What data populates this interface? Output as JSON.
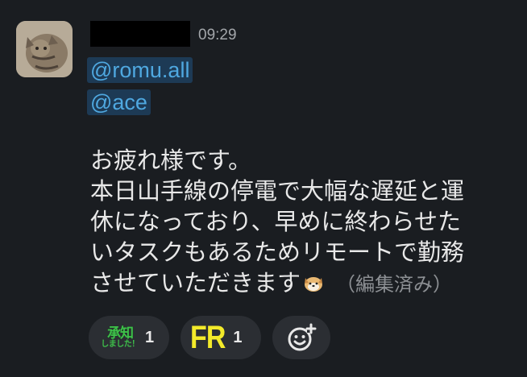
{
  "message": {
    "time": "09:29",
    "mentions": [
      "@romu.all",
      "@ace"
    ],
    "lines": [
      "お疲れ様です。",
      "本日山手線の停電で大幅な遅延と運",
      "休になっており、早めに終わらせた",
      "いタスクもあるためリモートで勤務",
      "させていただきます"
    ],
    "edited_label": "（編集済み）",
    "inline_emoji": "dog-face-emoji"
  },
  "reactions": [
    {
      "name": "承知しました",
      "text_top": "承知",
      "text_bottom": "しました！",
      "count": "1",
      "icon": "shonin-stamp"
    },
    {
      "name": "FR",
      "text": "FR",
      "count": "1",
      "icon": "fr-stamp"
    },
    {
      "name": "add-reaction",
      "icon": "add-reaction-icon"
    }
  ],
  "colors": {
    "background": "#1a1d21",
    "mention_bg": "#1d3a55",
    "mention_text": "#4fa8e0",
    "reaction_bg": "#2b2e33",
    "shonin_green": "#3ec04a",
    "fr_yellow": "#f3ea2a"
  }
}
